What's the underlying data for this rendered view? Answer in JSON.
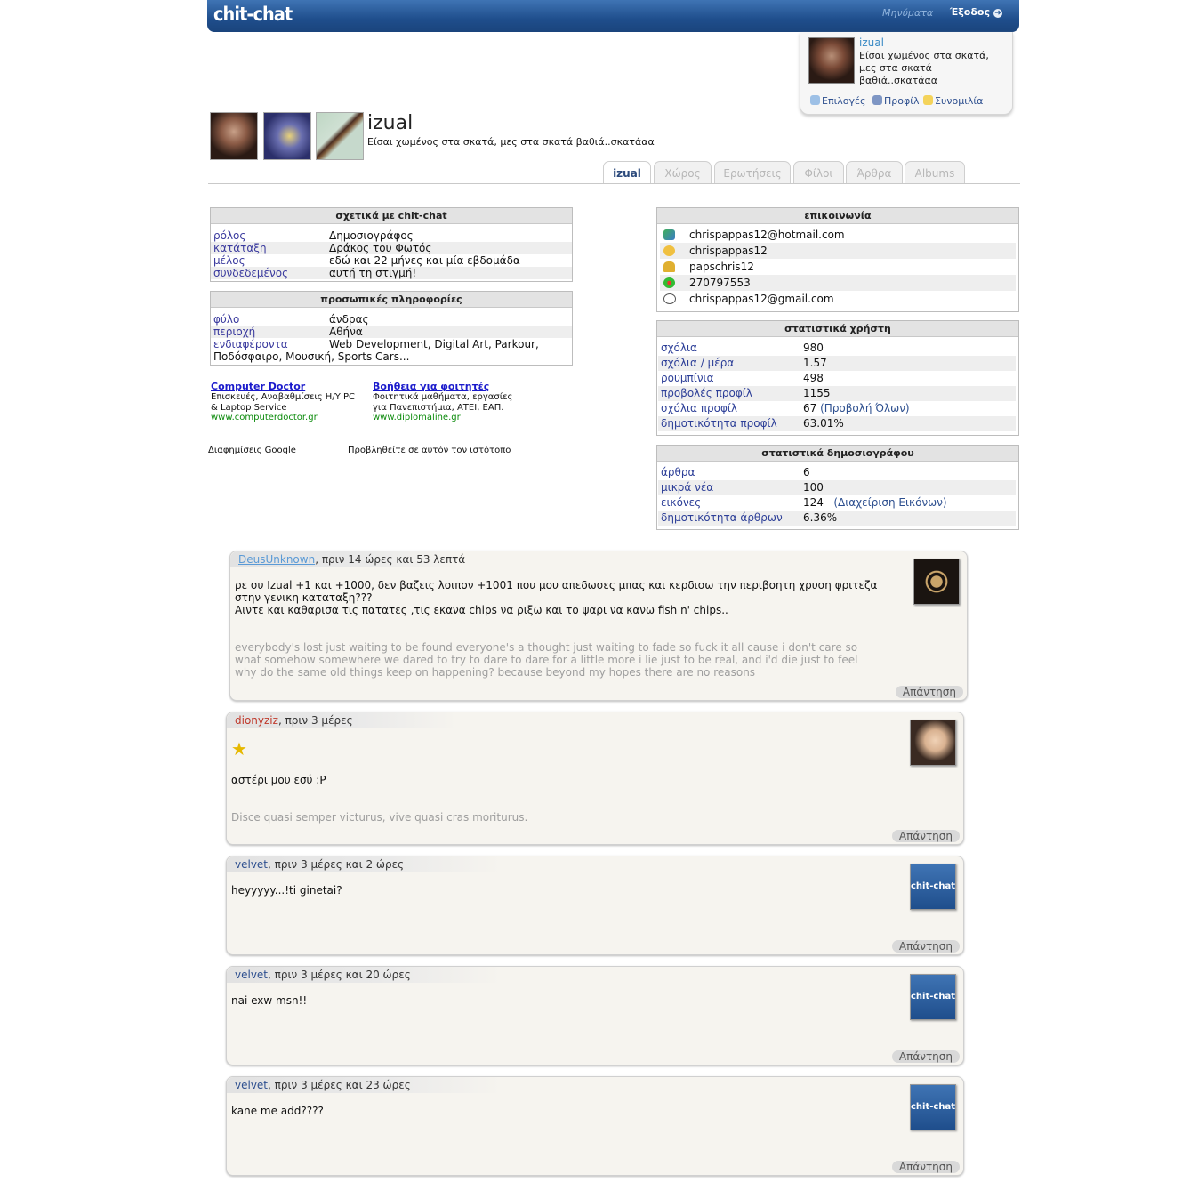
{
  "header": {
    "logo": "chit-chat",
    "messages": "Μηνύματα",
    "logout": "Έξοδος"
  },
  "userbox": {
    "name": "izual",
    "status": "Είσαι χωμένος στα σκατά, μες στα σκατά βαθιά..σκατάαα",
    "links": [
      "Επιλογές",
      "Προφίλ",
      "Συνομιλία"
    ]
  },
  "profile": {
    "title": "izual",
    "subtitle": "Είσαι χωμένος στα σκατά, μες στα σκατά βαθιά..σκατάαα"
  },
  "tabs": [
    "izual",
    "Χώρος",
    "Ερωτήσεις",
    "Φίλοι",
    "Άρθρα",
    "Albums"
  ],
  "about": {
    "title": "σχετικά με chit-chat",
    "rows": [
      {
        "k": "ρόλος",
        "v": "Δημοσιογράφος"
      },
      {
        "k": "κατάταξη",
        "v": "Δράκος του Φωτός"
      },
      {
        "k": "μέλος",
        "v": "εδώ και 22 μήνες και μία εβδομάδα"
      },
      {
        "k": "συνδεδεμένος",
        "v": "αυτή τη στιγμή!"
      }
    ]
  },
  "personal": {
    "title": "προσωπικές πληροφορίες",
    "rows": [
      {
        "k": "φύλο",
        "v": "άνδρας"
      },
      {
        "k": "περιοχή",
        "v": "Αθήνα"
      },
      {
        "k": "ενδιαφέροντα",
        "v": "Web Development, Digital Art, Parkour,"
      }
    ],
    "interests_cont": "Ποδόσφαιρο, Μουσική, Sports Cars..."
  },
  "ads": [
    {
      "title": "Computer Doctor",
      "line1": "Επισκευές, Αναβαθμίσεις Η/Υ PC",
      "line2": "& Laptop Service",
      "url": "www.computerdoctor.gr"
    },
    {
      "title": "Βοήθεια για φοιτητές",
      "line1": "Φοιτητικά μαθήματα, εργασίες",
      "line2": "για Πανεπιστήμια, ΑΤΕΙ, ΕΑΠ.",
      "url": "www.diplomaline.gr"
    }
  ],
  "ads_footer": {
    "google": "Διαφημίσεις Google",
    "advertise": "Προβληθείτε σε αυτόν τον ιστότοπο"
  },
  "contact": {
    "title": "επικοινωνία",
    "rows": [
      {
        "icon": "msn-icon",
        "v": "chrispappas12@hotmail.com"
      },
      {
        "icon": "yahoo-icon",
        "v": "chrispappas12"
      },
      {
        "icon": "aim-icon",
        "v": "papschris12"
      },
      {
        "icon": "icq-icon",
        "v": "270797553"
      },
      {
        "icon": "gtalk-icon",
        "v": "chrispappas12@gmail.com"
      }
    ]
  },
  "user_stats": {
    "title": "στατιστικά χρήστη",
    "rows": [
      {
        "k": "σχόλια",
        "v": "980"
      },
      {
        "k": "σχόλια / μέρα",
        "v": "1.57"
      },
      {
        "k": "ρουμπίνια",
        "v": "498"
      },
      {
        "k": "προβολές προφίλ",
        "v": "1155"
      },
      {
        "k": "σχόλια προφίλ",
        "v": "67",
        "link": "(Προβολή Όλων)"
      },
      {
        "k": "δημοτικότητα προφίλ",
        "v": "63.01%"
      }
    ]
  },
  "journalist_stats": {
    "title": "στατιστικά δημοσιογράφου",
    "rows": [
      {
        "k": "άρθρα",
        "v": "6"
      },
      {
        "k": "μικρά νέα",
        "v": "100"
      },
      {
        "k": "εικόνες",
        "v": "124",
        "link": "(Διαχείριση Εικόνων)"
      },
      {
        "k": "δημοτικότητα άρθρων",
        "v": "6.36%"
      }
    ]
  },
  "comments": [
    {
      "author": "DeusUnknown",
      "time": ", πριν 14 ώρες και 53 λεπτά",
      "body": [
        "ρε συ Izual +1 και +1000, δεν βαζεις λοιπον +1001 που μου απεδωσες μπας και κερδισω την περιβοητη χρυση φριτεζα",
        "στην γενικη καταταξη???",
        "Αιντε και καθαρισα τις πατατες ,τις εκανα chips να ριξω και το ψαρι να κανω fish n' chips.."
      ],
      "signature": [
        "everybody's lost just waiting to be found everyone's a thought just waiting to fade so fuck it all cause i don't care so",
        "what somehow somewhere we dared to try to dare to dare for a little more i lie just to be real, and i'd die just to feel",
        "why do the same old things keep on happening? because beyond my hopes there are no reasons"
      ],
      "reply": "Απάντηση"
    },
    {
      "author": "dionyziz",
      "time": ", πριν 3 μέρες",
      "body": [
        "αστέρι μου εσύ :P"
      ],
      "signature": [
        "Disce quasi semper victurus, vive quasi cras moriturus."
      ],
      "reply": "Απάντηση"
    },
    {
      "author": "velvet",
      "time": ", πριν 3 μέρες και 2 ώρες",
      "body": [
        "heyyyyy...!ti ginetai?"
      ],
      "reply": "Απάντηση"
    },
    {
      "author": "velvet",
      "time": ", πριν 3 μέρες και 20 ώρες",
      "body": [
        "nai exw msn!!"
      ],
      "reply": "Απάντηση"
    },
    {
      "author": "velvet",
      "time": ", πριν 3 μέρες και 23 ώρες",
      "body": [
        "kane me add????"
      ],
      "reply": "Απάντηση"
    }
  ],
  "avatar_logo_text": "chit-chat",
  "colors": {
    "brand": "#1f4e8c",
    "link": "#2d4f8f",
    "author_red": "#c0392b"
  }
}
